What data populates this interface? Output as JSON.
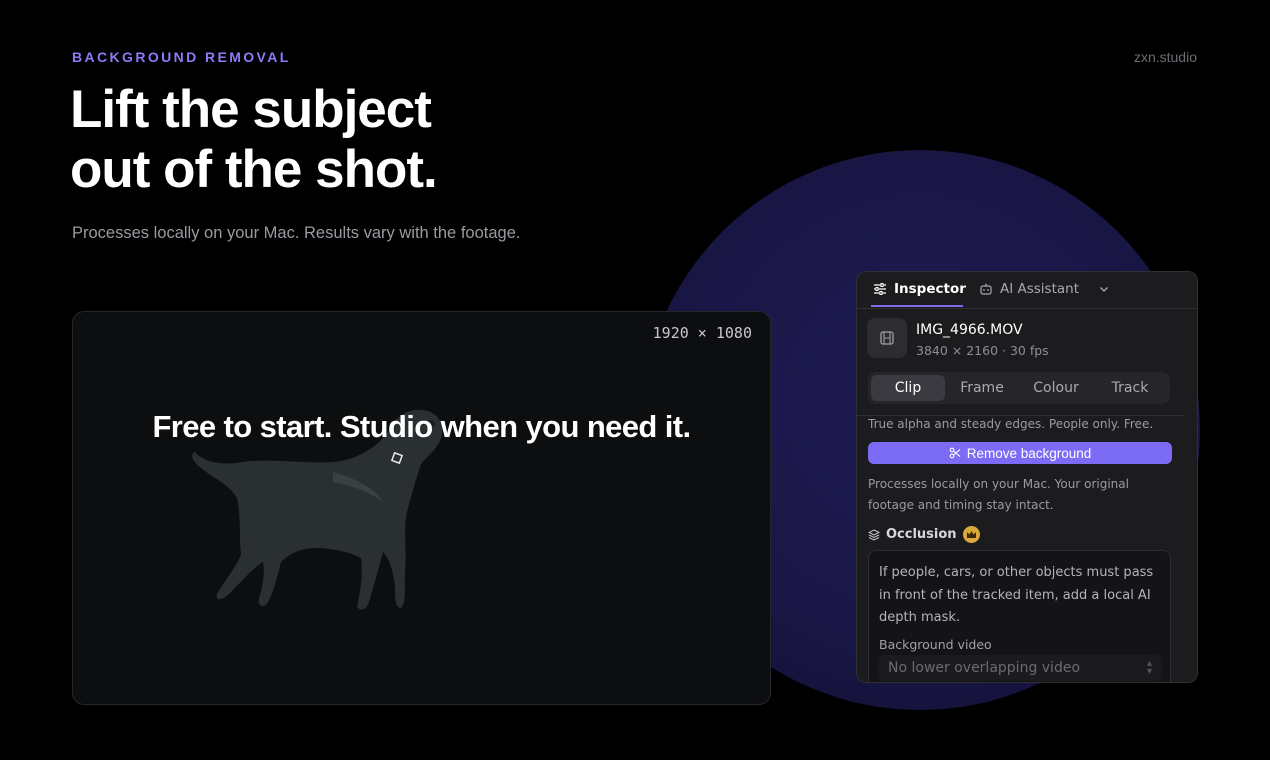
{
  "hero": {
    "eyebrow": "BACKGROUND REMOVAL",
    "brand": "zxn.studio",
    "headline_line1": "Lift the subject",
    "headline_line2": "out of the shot.",
    "subtitle": "Processes locally on your Mac. Results vary with the footage."
  },
  "preview": {
    "resolution": "1920 × 1080",
    "overlay_text": "Free to start. Studio when you need it."
  },
  "inspector": {
    "tabs": [
      {
        "label": "Inspector",
        "icon": "sliders-icon",
        "active": true
      },
      {
        "label": "AI Assistant",
        "icon": "robot-icon",
        "active": false
      }
    ],
    "file": {
      "name": "IMG_4966.MOV",
      "meta": "3840 × 2160 · 30 fps",
      "icon": "film-icon"
    },
    "segments": [
      "Clip",
      "Frame",
      "Colour",
      "Track"
    ],
    "selected_segment": "Clip",
    "alpha_note": "True alpha and steady edges. People only. Free.",
    "remove_button": "Remove background",
    "local_note": "Processes locally on your Mac. Your original footage and timing stay intact.",
    "occlusion": {
      "title": "Occlusion",
      "description": "If people, cars, or other objects must pass in front of the tracked item, add a local AI depth mask.",
      "bg_label": "Background video",
      "bg_value": "No lower overlapping video"
    }
  },
  "colors": {
    "accent": "#7c6cf5",
    "eyebrow": "#8b7bf6",
    "glow": "#1a1747",
    "crown": "#d9a93c"
  }
}
